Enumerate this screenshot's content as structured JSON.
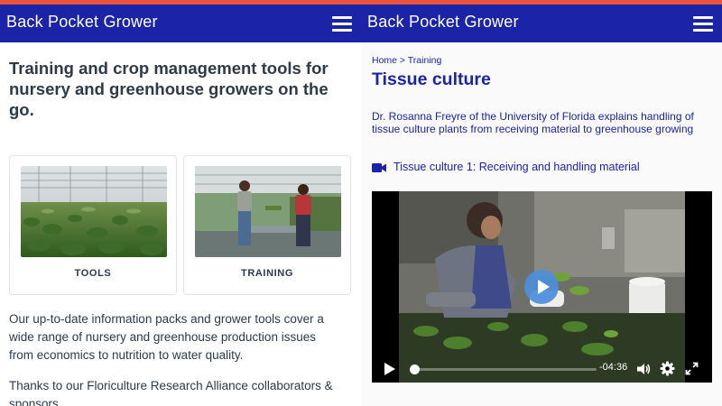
{
  "app": {
    "name": "Back Pocket Grower"
  },
  "home": {
    "headline": "Training and crop management tools for nursery and greenhouse growers on the go.",
    "cards": [
      {
        "label": "TOOLS"
      },
      {
        "label": "TRAINING"
      }
    ],
    "intro_text": "Our up-to-date information packs and grower tools cover a wide range of nursery and greenhouse production issues from economics to nutrition to water quality.",
    "thanks_text": "Thanks to our Floriculture Research Alliance collaborators & sponsors."
  },
  "detail": {
    "breadcrumb": "Home > Training",
    "title": "Tissue culture",
    "description": "Dr. Rosanna Freyre of the University of Florida explains handling of tissue culture plants from receiving material to greenhouse growing",
    "video_link": "Tissue culture 1: Receiving and handling material",
    "player": {
      "time_remaining": "-04:36",
      "progress": 0.0
    }
  },
  "colors": {
    "brand": "#1b23a6",
    "accent_stripe": "#e8533a",
    "text": "#2d3a4a",
    "play_button": "#4c8ed9"
  },
  "icons": [
    "hamburger-menu-icon",
    "video-camera-icon",
    "play-icon",
    "volume-icon",
    "settings-gear-icon",
    "fullscreen-icon"
  ]
}
